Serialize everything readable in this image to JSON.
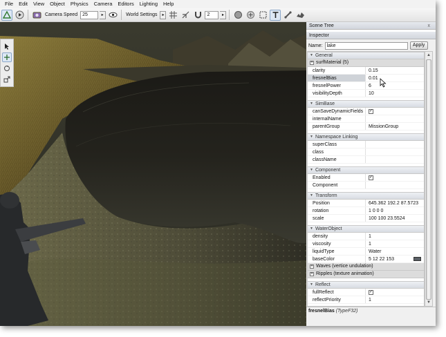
{
  "menubar": [
    "File",
    "Edit",
    "View",
    "Object",
    "Physics",
    "Camera",
    "Editors",
    "Lighting",
    "Help"
  ],
  "toolbar": {
    "camera_speed_label": "Camera Speed",
    "camera_speed_value": "25",
    "world_settings_label": "World Settings",
    "grid_value": "2"
  },
  "toolbar_icons": [
    "world-editor-icon",
    "play-icon",
    "camera-icon",
    "eye-icon",
    "grid-icon",
    "snap-icon",
    "magnet-icon",
    "sphere-icon",
    "add-icon",
    "select-icon",
    "text-icon",
    "bone-icon",
    "dragon-icon"
  ],
  "toolbar2_icons": [
    "object-icon",
    "terrain-icon",
    "road-icon",
    "sphere-icon",
    "cube-icon",
    "decal-icon",
    "material-icon",
    "river-icon",
    "mesh-icon",
    "brush-icon",
    "paint-icon",
    "particle-icon",
    "forest-icon",
    "shape-icon"
  ],
  "palette_icons": [
    "arrow-select-icon",
    "move-icon",
    "rotate-icon",
    "scale-icon"
  ],
  "panels": {
    "scene_tree_title": "Scene Tree",
    "scene_tree_close": "x",
    "inspector_title": "Inspector"
  },
  "namebar": {
    "label": "Name:",
    "value": "lake",
    "apply": "Apply"
  },
  "groups": {
    "general": {
      "title": "General",
      "surf_material": "surfMaterial (5)",
      "rows": [
        {
          "name": "clarity",
          "value": "0.15"
        },
        {
          "name": "fresnelBias",
          "value": "0.01"
        },
        {
          "name": "fresnelPower",
          "value": "6"
        },
        {
          "name": "visibilityDepth",
          "value": "10"
        }
      ]
    },
    "simbase": {
      "title": "SimBase",
      "rows": [
        {
          "name": "canSaveDynamicFields",
          "value": ""
        },
        {
          "name": "internalName",
          "value": ""
        },
        {
          "name": "parentGroup",
          "value": "MissionGroup"
        }
      ]
    },
    "namespace": {
      "title": "Namespace Linking",
      "rows": [
        {
          "name": "superClass",
          "value": ""
        },
        {
          "name": "class",
          "value": ""
        },
        {
          "name": "className",
          "value": ""
        }
      ]
    },
    "component": {
      "title": "Component",
      "rows": [
        {
          "name": "Enabled",
          "value": ""
        },
        {
          "name": "Component",
          "value": ""
        }
      ]
    },
    "transform": {
      "title": "Transform",
      "rows": [
        {
          "name": "Position",
          "value": "645.362 192.2 87.5723"
        },
        {
          "name": "rotation",
          "value": "1 0 0 0"
        },
        {
          "name": "scale",
          "value": "100 100 23.5524"
        }
      ]
    },
    "waterobject": {
      "title": "WaterObject",
      "rows": [
        {
          "name": "density",
          "value": "1"
        },
        {
          "name": "viscosity",
          "value": "1"
        },
        {
          "name": "liquidType",
          "value": "Water"
        },
        {
          "name": "baseColor",
          "value": "5 12 22 153"
        }
      ],
      "waves_label": "Waves (vertice undulation)",
      "ripples_label": "Ripples (texture animation)"
    },
    "reflect": {
      "title": "Reflect",
      "rows": [
        {
          "name": "fullReflect",
          "value": ""
        },
        {
          "name": "reflectPriority",
          "value": "1"
        }
      ]
    }
  },
  "status": {
    "field": "fresnelBias",
    "type": "(TypeF32)"
  },
  "colors": {
    "water": "#1e1e1a",
    "grass": "#6a5a2a",
    "base_color_swatch": "#5a6066"
  }
}
